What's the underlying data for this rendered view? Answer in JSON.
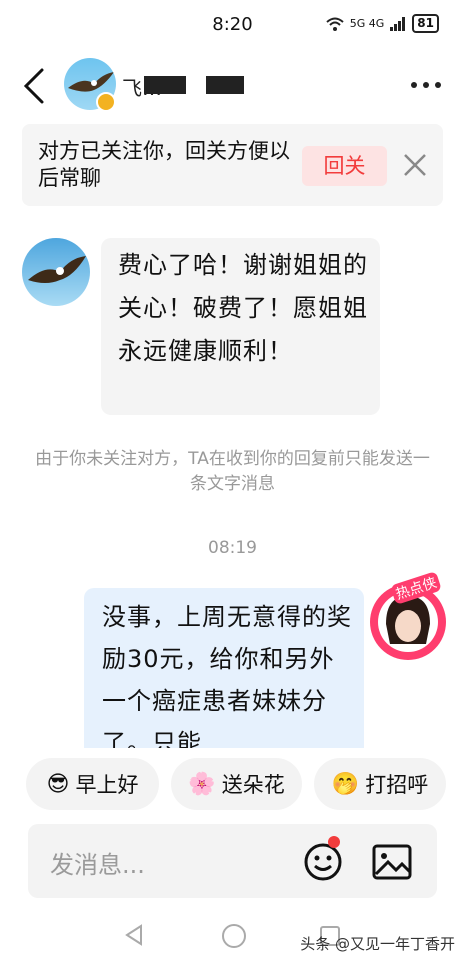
{
  "status_bar": {
    "time": "8:20",
    "network": "5G 4G",
    "battery": "81"
  },
  "header": {
    "contact_name": "飞…"
  },
  "follow_banner": {
    "text": "对方已关注你，回关方便以后常聊",
    "follow_button": "回关"
  },
  "messages": {
    "incoming_text": "费心了哈！谢谢姐姐的关心！破费了！愿姐姐永远健康顺利！",
    "system_note": "由于你未关注对方，TA在收到你的回复前只能发送一条文字消息",
    "timestamp": "08:19",
    "outgoing_text": "没事，上周无意得的奖励30元，给你和另外一个癌症患者妹妹分了。只能",
    "hot_tag": "热点侠"
  },
  "quick_replies": [
    {
      "emoji": "😎",
      "label": "早上好"
    },
    {
      "emoji": "🌸",
      "label": "送朵花"
    },
    {
      "emoji": "🤭",
      "label": "打招呼"
    }
  ],
  "input": {
    "placeholder": "发消息..."
  },
  "watermark": "头条 @又见一年丁香开"
}
